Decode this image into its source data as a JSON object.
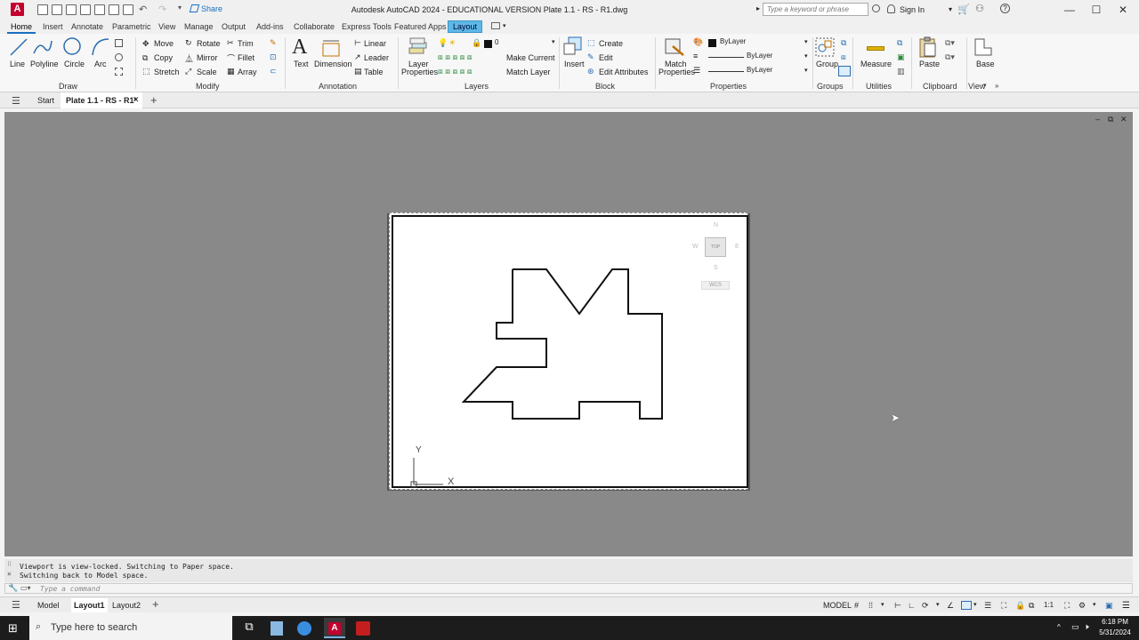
{
  "window": {
    "title": "Autodesk AutoCAD 2024 - EDUCATIONAL VERSION   Plate 1.1 - RS - R1.dwg",
    "app_logo": "A",
    "share_label": "Share",
    "search_placeholder": "Type a keyword or phrase",
    "sign_in": "Sign In"
  },
  "ribbon_tabs": [
    "Home",
    "Insert",
    "Annotate",
    "Parametric",
    "View",
    "Manage",
    "Output",
    "Add-ins",
    "Collaborate",
    "Express Tools",
    "Featured Apps",
    "Layout"
  ],
  "ribbon": {
    "draw": {
      "line": "Line",
      "polyline": "Polyline",
      "circle": "Circle",
      "arc": "Arc",
      "panel": "Draw"
    },
    "modify": {
      "move": "Move",
      "rotate": "Rotate",
      "trim": "Trim",
      "copy": "Copy",
      "mirror": "Mirror",
      "fillet": "Fillet",
      "stretch": "Stretch",
      "scale": "Scale",
      "array": "Array",
      "panel": "Modify"
    },
    "annotation": {
      "text": "Text",
      "dimension": "Dimension",
      "linear": "Linear",
      "leader": "Leader",
      "table": "Table",
      "panel": "Annotation"
    },
    "layers": {
      "layer_properties_1": "Layer",
      "layer_properties_2": "Properties",
      "layer_value": "0",
      "make_current": "Make Current",
      "match_layer": "Match Layer",
      "panel": "Layers"
    },
    "block": {
      "insert": "Insert",
      "create": "Create",
      "edit": "Edit",
      "edit_attributes": "Edit Attributes",
      "panel": "Block"
    },
    "properties": {
      "match_1": "Match",
      "match_2": "Properties",
      "color": "ByLayer",
      "linetype": "ByLayer",
      "lineweight": "ByLayer",
      "panel": "Properties"
    },
    "groups": {
      "group": "Group",
      "panel": "Groups"
    },
    "utilities": {
      "measure": "Measure",
      "panel": "Utilities"
    },
    "clipboard": {
      "paste": "Paste",
      "panel": "Clipboard"
    },
    "view": {
      "base": "Base",
      "panel": "View"
    }
  },
  "file_tabs": {
    "start": "Start",
    "active": "Plate 1.1 - RS - R1*"
  },
  "viewcube": {
    "north": "N",
    "south": "S",
    "east": "E",
    "west": "W",
    "face": "TOP",
    "wcs": "WCS"
  },
  "ucs": {
    "y": "Y",
    "x": "X"
  },
  "command": {
    "line1": "Viewport is view-locked. Switching to Paper space.",
    "line2": "Switching back to Model space.",
    "placeholder": "Type a command"
  },
  "layout_tabs": {
    "model": "Model",
    "layout1": "Layout1",
    "layout2": "Layout2"
  },
  "status": {
    "space": "MODEL",
    "scale": "1:1"
  },
  "taskbar": {
    "search": "Type here to search",
    "time": "6:18 PM",
    "date": "5/31/2024"
  },
  "colors": {
    "accent": "#1a6fc0",
    "logo": "#c4002f",
    "layout_tab": "#5eb8e6",
    "canvas": "#898989"
  }
}
